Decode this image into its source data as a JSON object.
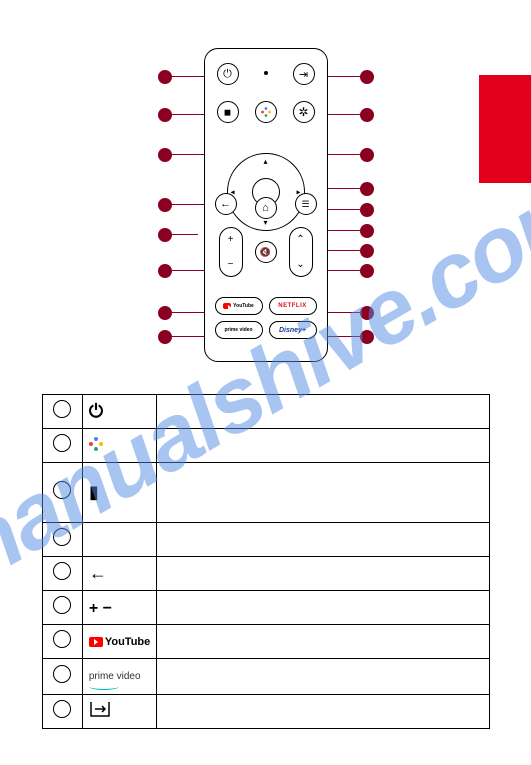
{
  "watermark": "manualshive.com",
  "remote": {
    "buttons": {
      "power": "⏻",
      "input": "⇥",
      "bookmark": "■",
      "assistant": "assistant",
      "settings": "✿",
      "back": "←",
      "home": "⌂",
      "guide": "☐",
      "vol_plus": "+",
      "vol_minus": "−",
      "mute": "🔇",
      "ch_up": "⌃",
      "ch_down": "⌄"
    },
    "app_buttons": {
      "youtube": "YouTube",
      "netflix": "NETFLIX",
      "primevideo": "prime video",
      "disney": "Disney+"
    }
  },
  "table": {
    "rows": [
      {
        "icon_type": "power",
        "icon": "⏻",
        "desc": ""
      },
      {
        "icon_type": "assistant",
        "icon": "",
        "desc": ""
      },
      {
        "icon_type": "bookmark",
        "icon": "▮",
        "desc": ""
      },
      {
        "icon_type": "none",
        "icon": "",
        "desc": ""
      },
      {
        "icon_type": "back",
        "icon": "←",
        "desc": ""
      },
      {
        "icon_type": "plusminus",
        "icon": "+ −",
        "desc": ""
      },
      {
        "icon_type": "youtube",
        "icon": "YouTube",
        "desc": ""
      },
      {
        "icon_type": "primevideo",
        "icon": "prime video",
        "desc": ""
      },
      {
        "icon_type": "input",
        "icon": "⇥",
        "desc": ""
      }
    ]
  }
}
